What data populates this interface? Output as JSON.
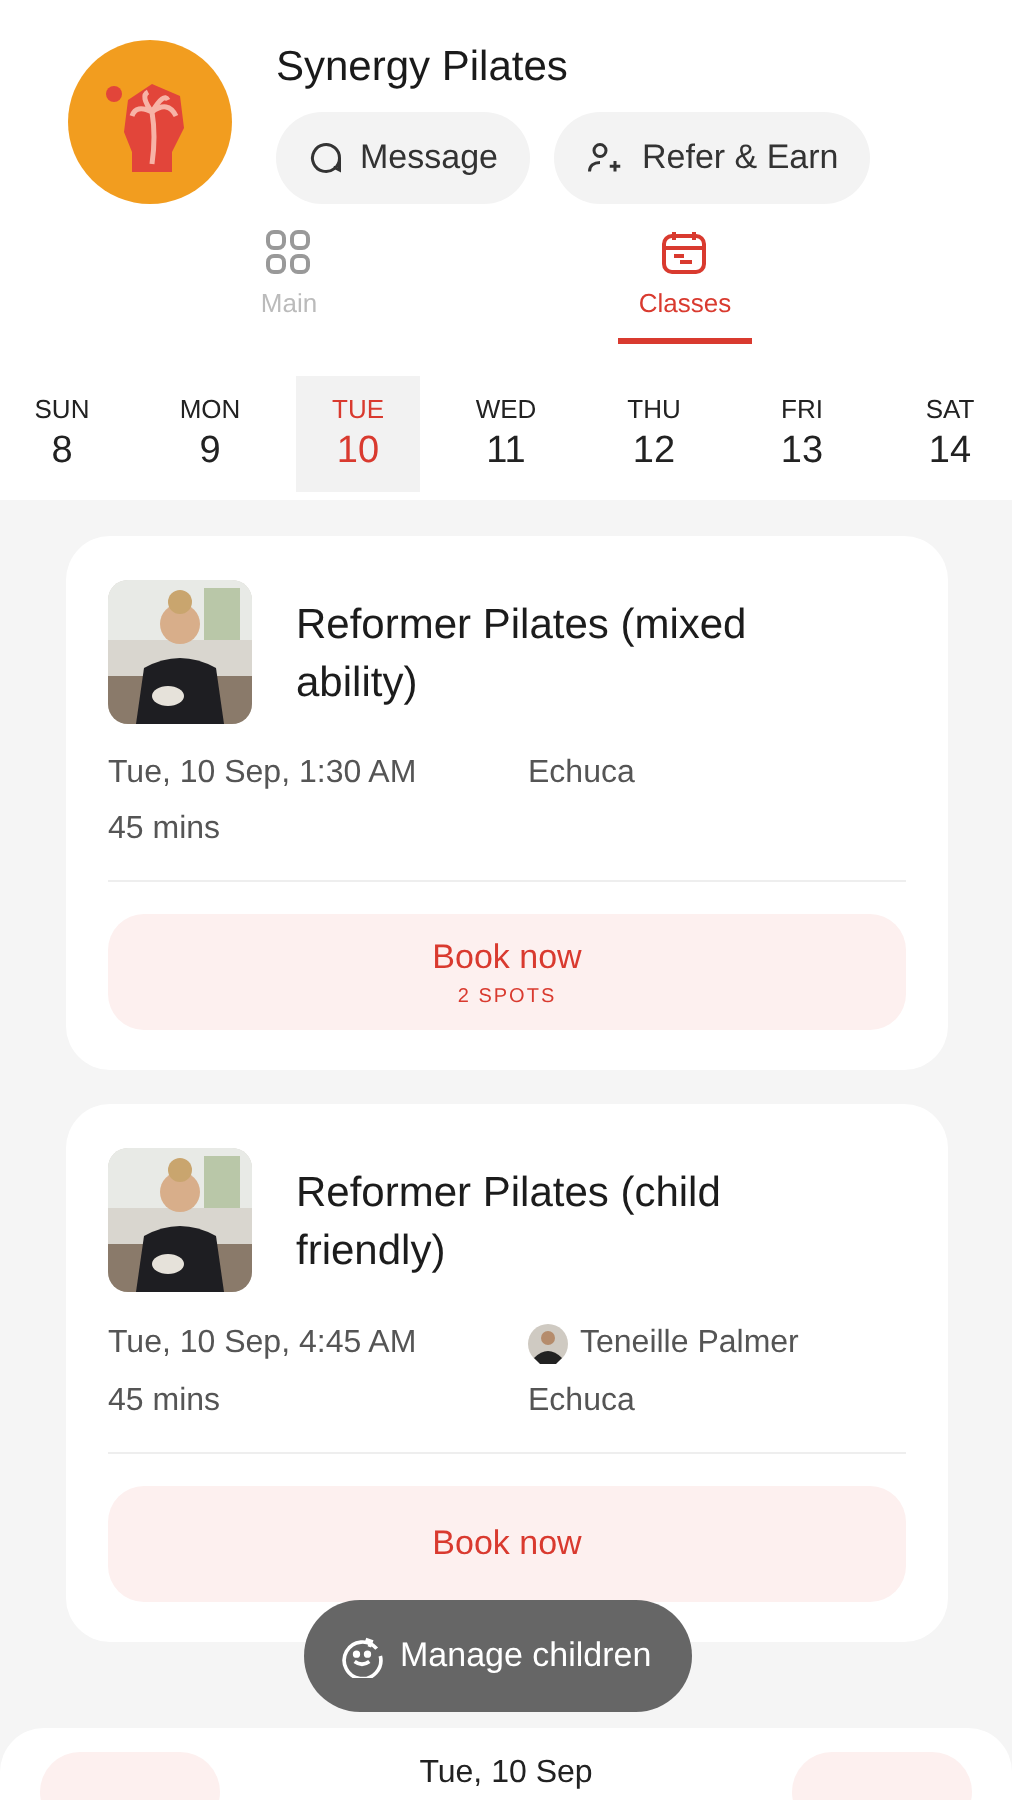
{
  "studio": {
    "name": "Synergy Pilates"
  },
  "actions": [
    {
      "kind": "message",
      "label": "Message"
    },
    {
      "kind": "refer",
      "label": "Refer & Earn"
    }
  ],
  "tabs": [
    {
      "kind": "main",
      "label": "Main",
      "selected": false
    },
    {
      "kind": "classes",
      "label": "Classes",
      "selected": true
    }
  ],
  "days": [
    {
      "weekday": "SUN",
      "date": "8",
      "selected": false
    },
    {
      "weekday": "MON",
      "date": "9",
      "selected": false
    },
    {
      "weekday": "TUE",
      "date": "10",
      "selected": true
    },
    {
      "weekday": "WED",
      "date": "11",
      "selected": false
    },
    {
      "weekday": "THU",
      "date": "12",
      "selected": false
    },
    {
      "weekday": "FRI",
      "date": "13",
      "selected": false
    },
    {
      "weekday": "SAT",
      "date": "14",
      "selected": false
    }
  ],
  "classes": [
    {
      "title": "Reformer Pilates (mixed ability)",
      "time": "Tue, 10 Sep, 1:30 AM",
      "duration": "45 mins",
      "location": "Echuca",
      "button": "Book now",
      "spots": "2 SPOTS"
    },
    {
      "title": "Reformer Pilates (child friendly)",
      "time": "Tue, 10 Sep, 4:45 AM",
      "duration": "45 mins",
      "instructor": "Teneille Palmer",
      "location": "Echuca",
      "button": "Book now"
    }
  ],
  "floating_button": {
    "label": "Manage children"
  },
  "bottom_bar": {
    "date": "Tue, 10 Sep"
  }
}
